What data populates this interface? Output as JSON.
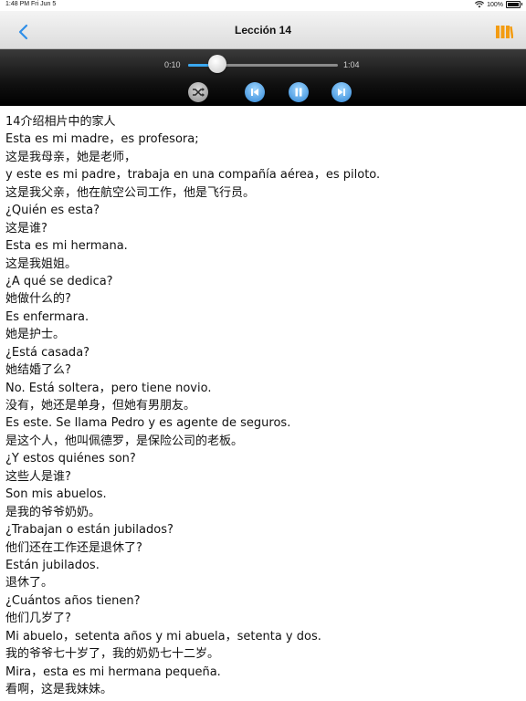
{
  "status_bar": {
    "time": "1:48 PM",
    "date": "Fri Jun 5",
    "battery": "100%"
  },
  "nav": {
    "title": "Lección 14",
    "back_icon": "chevron-left-icon",
    "library_icon": "library-icon",
    "accent_color": "#f39c12"
  },
  "player": {
    "current_time": "0:10",
    "duration": "1:04",
    "progress": 0.16
  },
  "lesson_lines": [
    "14介绍相片中的家人",
    "Esta es mi madre，es profesora;",
    "这是我母亲，她是老师，",
    "y este es mi padre，trabaja en una compañía aérea，es piloto.",
    "这是我父亲，他在航空公司工作，他是飞行员。",
    "¿Quién es esta?",
    "这是谁?",
    "Esta es mi hermana.",
    "这是我姐姐。",
    "¿A qué se dedica?",
    "她做什么的?",
    "Es enfermara.",
    "她是护士。",
    "¿Está casada?",
    "她结婚了么?",
    "No.  Está soltera，pero tiene novio.",
    "没有，她还是单身，但她有男朋友。",
    "Es este.  Se llama Pedro y es agente de seguros.",
    "是这个人，他叫佩德罗，是保险公司的老板。",
    "¿Y estos quiénes son?",
    "这些人是谁?",
    "Son mis abuelos.",
    "是我的爷爷奶奶。",
    "¿Trabajan o están jubilados?",
    "他们还在工作还是退休了?",
    "Están jubilados.",
    "退休了。",
    "¿Cuántos años tienen?",
    "他们几岁了?",
    "Mi abuelo，setenta años y mi abuela，setenta y dos.",
    "我的爷爷七十岁了，我的奶奶七十二岁。",
    "Mira，esta es mi hermana pequeña.",
    "看啊，这是我妹妹。"
  ]
}
